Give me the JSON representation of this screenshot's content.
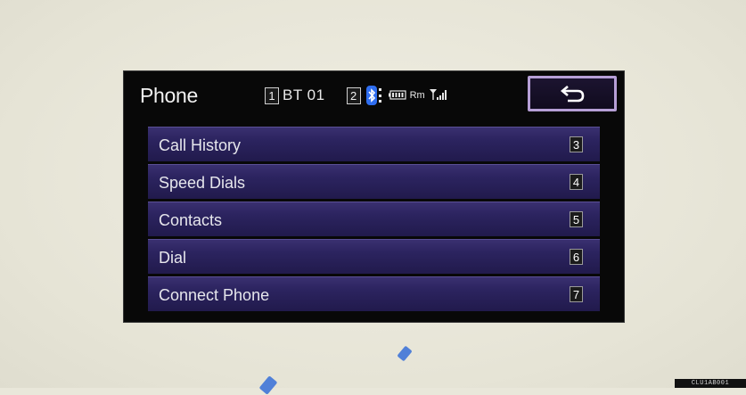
{
  "header": {
    "title": "Phone",
    "slot1_number": "1",
    "device_name": "BT 01",
    "slot2_number": "2",
    "roaming": "Rm"
  },
  "menu": {
    "items": [
      {
        "label": "Call History",
        "number": "3"
      },
      {
        "label": "Speed Dials",
        "number": "4"
      },
      {
        "label": "Contacts",
        "number": "5"
      },
      {
        "label": "Dial",
        "number": "6"
      },
      {
        "label": "Connect Phone",
        "number": "7"
      }
    ]
  },
  "footer": {
    "code": "CLU1AB001"
  },
  "icons": {
    "bluetooth": "bluetooth-icon",
    "battery": "battery-icon",
    "signal": "signal-strength-icon",
    "back": "back-arrow-icon"
  },
  "colors": {
    "accent_blue": "#2f6ef0",
    "menu_purple": "#2c2460",
    "back_border": "#b69fd6"
  }
}
